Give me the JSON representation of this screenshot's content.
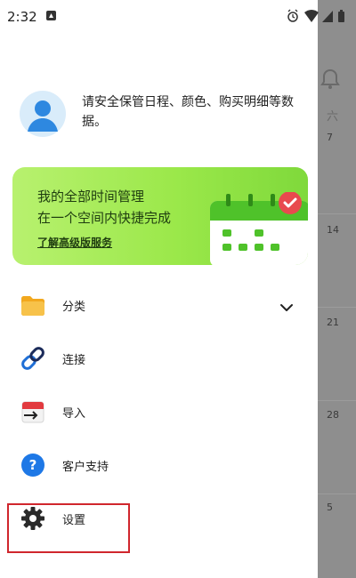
{
  "status_bar": {
    "time": "2:32"
  },
  "profile": {
    "message": "请安全保管日程、颜色、购买明细等数据。"
  },
  "banner": {
    "line1": "我的全部时间管理",
    "line2": "在一个空间内快捷完成",
    "link": "了解高级版服务"
  },
  "menu": {
    "items": [
      {
        "label": "分类",
        "icon": "folder-icon",
        "has_chevron": true
      },
      {
        "label": "连接",
        "icon": "link-icon"
      },
      {
        "label": "导入",
        "icon": "import-calendar-icon"
      },
      {
        "label": "客户支持",
        "icon": "help-icon"
      },
      {
        "label": "设置",
        "icon": "gear-icon"
      }
    ]
  },
  "background_calendar": {
    "weekday": "六",
    "dates": [
      "7",
      "14",
      "21",
      "28",
      "5"
    ]
  },
  "colors": {
    "banner_green": "#9be84a",
    "highlight_red": "#d0262d",
    "accent_blue": "#2e88e0"
  }
}
